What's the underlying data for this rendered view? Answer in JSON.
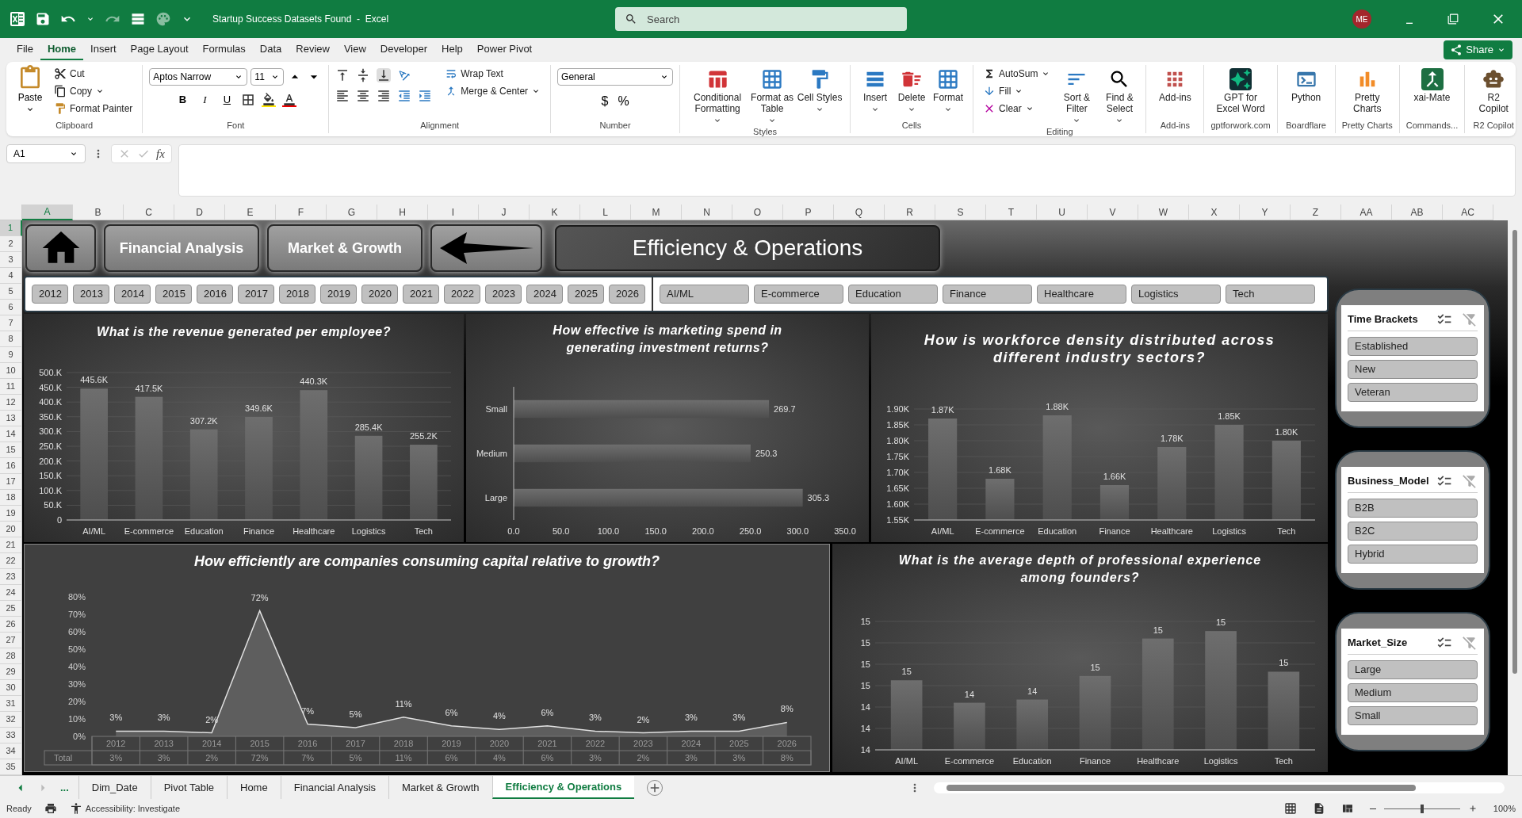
{
  "title_bar": {
    "title": "Startup Success Datasets Found  -  Excel",
    "search_placeholder": "Search",
    "user_initials": "ME"
  },
  "menu_tabs": [
    {
      "label": "File",
      "selected": false
    },
    {
      "label": "Home",
      "selected": true
    },
    {
      "label": "Insert",
      "selected": false
    },
    {
      "label": "Page Layout",
      "selected": false
    },
    {
      "label": "Formulas",
      "selected": false
    },
    {
      "label": "Data",
      "selected": false
    },
    {
      "label": "Review",
      "selected": false
    },
    {
      "label": "View",
      "selected": false
    },
    {
      "label": "Developer",
      "selected": false
    },
    {
      "label": "Help",
      "selected": false
    },
    {
      "label": "Power Pivot",
      "selected": false
    }
  ],
  "share_button": "Share",
  "ribbon": {
    "clipboard": {
      "name": "Clipboard",
      "paste": "Paste",
      "cut": "Cut",
      "copy": "Copy",
      "format_painter": "Format Painter"
    },
    "font": {
      "name": "Font",
      "font_name": "Aptos Narrow",
      "font_size": "11",
      "bold": "B",
      "italic": "I",
      "underline": "U"
    },
    "alignment": {
      "name": "Alignment",
      "wrap_text": "Wrap Text",
      "merge": "Merge & Center"
    },
    "number": {
      "name": "Number",
      "format": "General",
      "currency": "$",
      "percent": "%"
    },
    "styles": {
      "name": "Styles",
      "buttons": [
        {
          "label": "Conditional Formatting",
          "menu": true
        },
        {
          "label": "Format as Table",
          "menu": true
        },
        {
          "label": "Cell Styles",
          "menu": true
        }
      ]
    },
    "cells": {
      "name": "Cells",
      "buttons": [
        {
          "label": "Insert",
          "menu": true
        },
        {
          "label": "Delete",
          "menu": true
        },
        {
          "label": "Format",
          "menu": true
        }
      ]
    },
    "editing": {
      "name": "Editing",
      "autosum": "AutoSum",
      "fill": "Fill",
      "clear": "Clear",
      "sort": "Sort & Filter",
      "find": "Find & Select"
    },
    "addins": [
      {
        "name": "Add-ins",
        "label": "Add-ins"
      },
      {
        "name": "gptforwork.com",
        "label": "GPT for Excel Word"
      },
      {
        "name": "Boardflare",
        "label": "Python"
      },
      {
        "name": "Pretty Charts",
        "label": "Pretty Charts"
      },
      {
        "name": "Commands...",
        "label": "xai-Mate"
      },
      {
        "name": "R2 Copilot",
        "label": "R2 Copilot"
      }
    ]
  },
  "formula_bar": {
    "name_box": "A1",
    "function_label": "fx"
  },
  "columns": [
    {
      "label": "A",
      "selected": true
    },
    {
      "label": "B",
      "selected": false
    },
    {
      "label": "C",
      "selected": false
    },
    {
      "label": "D",
      "selected": false
    },
    {
      "label": "E",
      "selected": false
    },
    {
      "label": "F",
      "selected": false
    },
    {
      "label": "G",
      "selected": false
    },
    {
      "label": "H",
      "selected": false
    },
    {
      "label": "I",
      "selected": false
    },
    {
      "label": "J",
      "selected": false
    },
    {
      "label": "K",
      "selected": false
    },
    {
      "label": "L",
      "selected": false
    },
    {
      "label": "M",
      "selected": false
    },
    {
      "label": "N",
      "selected": false
    },
    {
      "label": "O",
      "selected": false
    },
    {
      "label": "P",
      "selected": false
    },
    {
      "label": "Q",
      "selected": false
    },
    {
      "label": "R",
      "selected": false
    },
    {
      "label": "S",
      "selected": false
    },
    {
      "label": "T",
      "selected": false
    },
    {
      "label": "U",
      "selected": false
    },
    {
      "label": "V",
      "selected": false
    },
    {
      "label": "W",
      "selected": false
    },
    {
      "label": "X",
      "selected": false
    },
    {
      "label": "Y",
      "selected": false
    },
    {
      "label": "Z",
      "selected": false
    },
    {
      "label": "AA",
      "selected": false
    },
    {
      "label": "AB",
      "selected": false
    },
    {
      "label": "AC",
      "selected": false
    }
  ],
  "rows": [
    {
      "label": "1",
      "selected": true
    },
    {
      "label": "2",
      "selected": false
    },
    {
      "label": "3",
      "selected": false
    },
    {
      "label": "4",
      "selected": false
    },
    {
      "label": "5",
      "selected": false
    },
    {
      "label": "6",
      "selected": false
    },
    {
      "label": "7",
      "selected": false
    },
    {
      "label": "8",
      "selected": false
    },
    {
      "label": "9",
      "selected": false
    },
    {
      "label": "10",
      "selected": false
    },
    {
      "label": "11",
      "selected": false
    },
    {
      "label": "12",
      "selected": false
    },
    {
      "label": "13",
      "selected": false
    },
    {
      "label": "14",
      "selected": false
    },
    {
      "label": "15",
      "selected": false
    },
    {
      "label": "16",
      "selected": false
    },
    {
      "label": "17",
      "selected": false
    },
    {
      "label": "18",
      "selected": false
    },
    {
      "label": "19",
      "selected": false
    },
    {
      "label": "20",
      "selected": false
    },
    {
      "label": "21",
      "selected": false
    },
    {
      "label": "22",
      "selected": false
    },
    {
      "label": "23",
      "selected": false
    },
    {
      "label": "24",
      "selected": false
    },
    {
      "label": "25",
      "selected": false
    },
    {
      "label": "26",
      "selected": false
    },
    {
      "label": "27",
      "selected": false
    },
    {
      "label": "28",
      "selected": false
    },
    {
      "label": "29",
      "selected": false
    },
    {
      "label": "30",
      "selected": false
    },
    {
      "label": "31",
      "selected": false
    },
    {
      "label": "32",
      "selected": false
    },
    {
      "label": "33",
      "selected": false
    },
    {
      "label": "34",
      "selected": false
    },
    {
      "label": "35",
      "selected": false
    }
  ],
  "dashboard": {
    "nav_buttons": [
      {
        "kind": "home"
      },
      {
        "kind": "text",
        "label": "Financial Analysis"
      },
      {
        "kind": "text",
        "label": "Market & Growth"
      },
      {
        "kind": "back"
      }
    ],
    "page_title": "Efficiency & Operations",
    "year_slicer": [
      {
        "label": "2012",
        "selected": true
      },
      {
        "label": "2013",
        "selected": true
      },
      {
        "label": "2014",
        "selected": true
      },
      {
        "label": "2015",
        "selected": true
      },
      {
        "label": "2016",
        "selected": true
      },
      {
        "label": "2017",
        "selected": true
      },
      {
        "label": "2018",
        "selected": true
      },
      {
        "label": "2019",
        "selected": true
      },
      {
        "label": "2020",
        "selected": true
      },
      {
        "label": "2021",
        "selected": true
      },
      {
        "label": "2022",
        "selected": true
      },
      {
        "label": "2023",
        "selected": true
      },
      {
        "label": "2024",
        "selected": true
      },
      {
        "label": "2025",
        "selected": true
      },
      {
        "label": "2026",
        "selected": true
      }
    ],
    "industry_slicer": [
      {
        "label": "AI/ML",
        "selected": true
      },
      {
        "label": "E-commerce",
        "selected": true
      },
      {
        "label": "Education",
        "selected": true
      },
      {
        "label": "Finance",
        "selected": true
      },
      {
        "label": "Healthcare",
        "selected": true
      },
      {
        "label": "Logistics",
        "selected": true
      },
      {
        "label": "Tech",
        "selected": true
      }
    ],
    "charts": [
      {
        "title": "What is the revenue generated per employee?",
        "chart_data": {
          "type": "bar",
          "categories": [
            "AI/ML",
            "E-commerce",
            "Education",
            "Finance",
            "Healthcare",
            "Logistics",
            "Tech"
          ],
          "series": [
            {
              "color": "#6e6e6e",
              "values": [
                445.6,
                417.5,
                307.2,
                349.6,
                440.3,
                285.4,
                255.2
              ]
            }
          ],
          "grid": true,
          "ylim": [
            0,
            500
          ],
          "yticks": [
            {
              "value": 0,
              "label": "0"
            },
            {
              "value": 50,
              "label": "50.K"
            },
            {
              "value": 100,
              "label": "100.K"
            },
            {
              "value": 150,
              "label": "150.K"
            },
            {
              "value": 200,
              "label": "200.K"
            },
            {
              "value": 250,
              "label": "250.K"
            },
            {
              "value": 300,
              "label": "300.K"
            },
            {
              "value": 350,
              "label": "350.K"
            },
            {
              "value": 400,
              "label": "400.K"
            },
            {
              "value": 450,
              "label": "450.K"
            },
            {
              "value": 500,
              "label": "500.K"
            }
          ],
          "value_labels": [
            "445.6K",
            "417.5K",
            "307.2K",
            "349.6K",
            "440.3K",
            "285.4K",
            "255.2K"
          ]
        }
      },
      {
        "title": "How effective is marketing spend in generating investment returns?",
        "chart_data": {
          "type": "bar",
          "orientation": "horizontal",
          "categories": [
            "Small",
            "Medium",
            "Large"
          ],
          "series": [
            {
              "color": "#6e6e6e",
              "values": [
                269.7,
                250.3,
                305.3
              ]
            }
          ],
          "xlim": [
            0,
            350
          ],
          "xticks": [
            {
              "value": 0,
              "label": "0.0"
            },
            {
              "value": 50,
              "label": "50.0"
            },
            {
              "value": 100,
              "label": "100.0"
            },
            {
              "value": 150,
              "label": "150.0"
            },
            {
              "value": 200,
              "label": "200.0"
            },
            {
              "value": 250,
              "label": "250.0"
            },
            {
              "value": 300,
              "label": "300.0"
            },
            {
              "value": 350,
              "label": "350.0"
            }
          ],
          "value_labels": [
            "269.7",
            "250.3",
            "305.3"
          ]
        }
      },
      {
        "title": "How is workforce density distributed across different industry sectors?",
        "chart_data": {
          "type": "bar",
          "categories": [
            "AI/ML",
            "E-commerce",
            "Education",
            "Finance",
            "Healthcare",
            "Logistics",
            "Tech"
          ],
          "series": [
            {
              "color": "#6e6e6e",
              "values": [
                1870,
                1680,
                1880,
                1660,
                1780,
                1850,
                1800
              ]
            }
          ],
          "grid": true,
          "ylim": [
            1550,
            1900
          ],
          "yticks": [
            {
              "value": 1550,
              "label": "1.55K"
            },
            {
              "value": 1600,
              "label": "1.60K"
            },
            {
              "value": 1650,
              "label": "1.65K"
            },
            {
              "value": 1700,
              "label": "1.70K"
            },
            {
              "value": 1750,
              "label": "1.75K"
            },
            {
              "value": 1800,
              "label": "1.80K"
            },
            {
              "value": 1850,
              "label": "1.85K"
            },
            {
              "value": 1900,
              "label": "1.90K"
            }
          ],
          "value_labels": [
            "1.87K",
            "1.68K",
            "1.88K",
            "1.66K",
            "1.78K",
            "1.85K",
            "1.80K"
          ]
        }
      },
      {
        "title": "How efficiently are companies consuming capital relative to growth?",
        "chart_data": {
          "type": "area",
          "x": [
            "2012",
            "2013",
            "2014",
            "2015",
            "2016",
            "2017",
            "2018",
            "2019",
            "2020",
            "2021",
            "2022",
            "2023",
            "2024",
            "2025",
            "2026"
          ],
          "series": [
            {
              "name": "Total",
              "color": "#e0e0e0",
              "values": [
                3,
                3,
                2,
                72,
                7,
                5,
                11,
                6,
                4,
                6,
                3,
                2,
                3,
                3,
                8
              ]
            }
          ],
          "ylim": [
            0,
            80
          ],
          "yticks": [
            {
              "value": 0,
              "label": "0%"
            },
            {
              "value": 10,
              "label": "10%"
            },
            {
              "value": 20,
              "label": "20%"
            },
            {
              "value": 30,
              "label": "30%"
            },
            {
              "value": 40,
              "label": "40%"
            },
            {
              "value": 50,
              "label": "50%"
            },
            {
              "value": 60,
              "label": "60%"
            },
            {
              "value": 70,
              "label": "70%"
            },
            {
              "value": 80,
              "label": "80%"
            }
          ],
          "value_labels": [
            "3%",
            "3%",
            "2%",
            "72%",
            "7%",
            "5%",
            "11%",
            "6%",
            "4%",
            "6%",
            "3%",
            "2%",
            "3%",
            "3%",
            "8%"
          ]
        },
        "data_table": {
          "cells": [
            "3%",
            "3%",
            "2%",
            "72%",
            "7%",
            "5%",
            "11%",
            "6%",
            "4%",
            "6%",
            "3%",
            "2%",
            "3%",
            "3%",
            "8%"
          ]
        }
      },
      {
        "title": "What is the average depth of professional experience among founders?",
        "chart_data": {
          "type": "bar",
          "categories": [
            "AI/ML",
            "E-commerce",
            "Education",
            "Finance",
            "Healthcare",
            "Logistics",
            "Tech"
          ],
          "series": [
            {
              "color": "#6e6e6e",
              "values": [
                14.65,
                14.44,
                14.47,
                14.69,
                15.04,
                15.11,
                14.73
              ]
            }
          ],
          "grid": true,
          "ylim": [
            14,
            15.2
          ],
          "yticks": [
            {
              "value": 14,
              "label": "14"
            },
            {
              "value": 14.2,
              "label": "14"
            },
            {
              "value": 14.4,
              "label": "14"
            },
            {
              "value": 14.6,
              "label": "15"
            },
            {
              "value": 14.8,
              "label": "15"
            },
            {
              "value": 15,
              "label": "15"
            },
            {
              "value": 15.2,
              "label": "15"
            }
          ],
          "value_labels": [
            "15",
            "14",
            "14",
            "15",
            "15",
            "15",
            "15"
          ]
        }
      }
    ],
    "side_slicers": [
      {
        "title": "Time Brackets",
        "items": [
          {
            "label": "Established",
            "selected": true
          },
          {
            "label": "New",
            "selected": true
          },
          {
            "label": "Veteran",
            "selected": true
          }
        ]
      },
      {
        "title": "Business_Model",
        "items": [
          {
            "label": "B2B",
            "selected": true
          },
          {
            "label": "B2C",
            "selected": true
          },
          {
            "label": "Hybrid",
            "selected": true
          }
        ]
      },
      {
        "title": "Market_Size",
        "items": [
          {
            "label": "Large",
            "selected": true
          },
          {
            "label": "Medium",
            "selected": true
          },
          {
            "label": "Small",
            "selected": true
          }
        ]
      }
    ]
  },
  "sheet_tabs": {
    "overflow": "...",
    "tabs": [
      {
        "label": "Dim_Date",
        "selected": false
      },
      {
        "label": "Pivot Table",
        "selected": false
      },
      {
        "label": "Home",
        "selected": false
      },
      {
        "label": "Financial Analysis",
        "selected": false
      },
      {
        "label": "Market & Growth",
        "selected": false
      },
      {
        "label": "Efficiency & Operations",
        "selected": true
      }
    ]
  },
  "status_bar": {
    "status": "Ready",
    "accessibility": "Accessibility: Investigate",
    "zoom": {
      "level": 0.5,
      "reading": "100%"
    }
  }
}
